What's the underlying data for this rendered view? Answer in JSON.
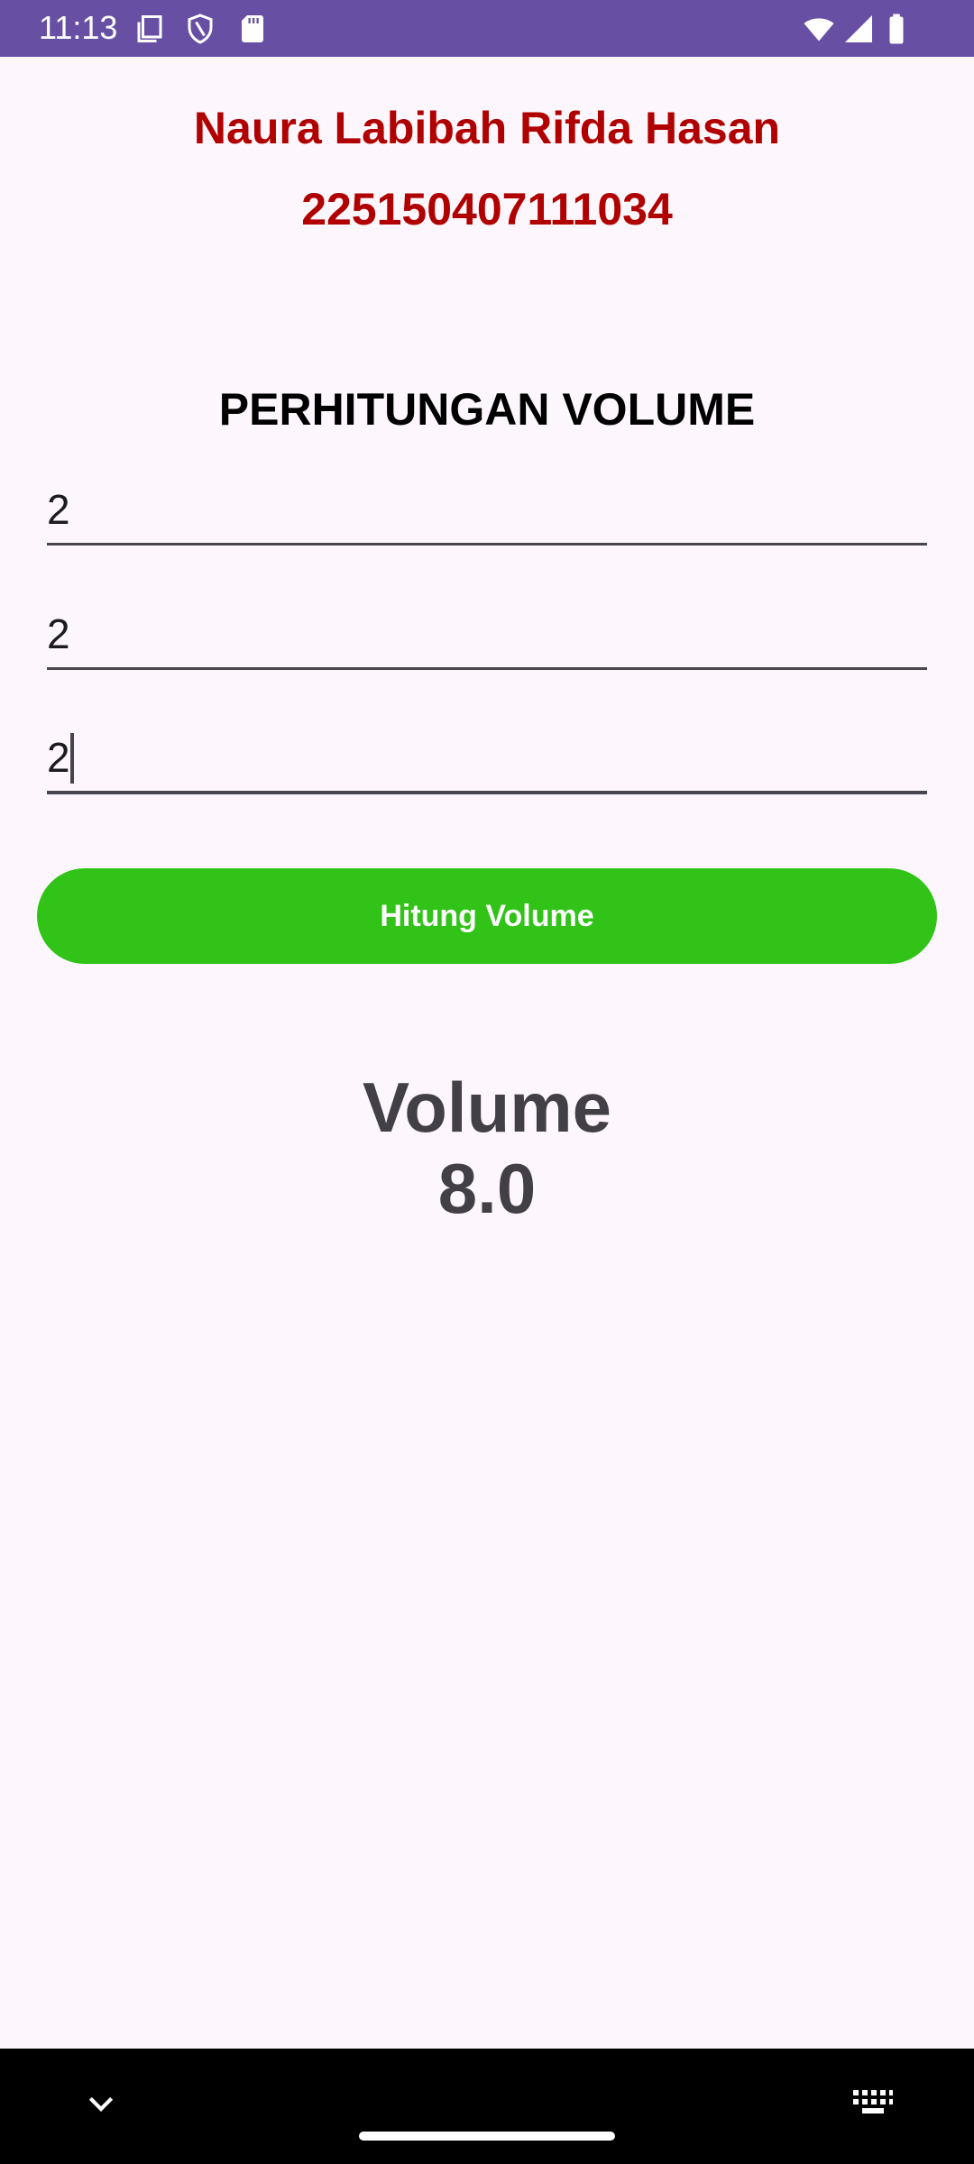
{
  "status_bar": {
    "time": "11:13",
    "icons": [
      "copy-icon",
      "shield-icon",
      "sd-card-icon",
      "wifi-icon",
      "signal-icon",
      "battery-icon"
    ],
    "color": "#6750A4"
  },
  "header": {
    "name": "Naura Labibah Rifda Hasan",
    "nim": "225150407111034",
    "color": "#B00000"
  },
  "section_title": "PERHITUNGAN VOLUME",
  "inputs": [
    {
      "value": "2"
    },
    {
      "value": "2"
    },
    {
      "value": "2",
      "focused": true
    }
  ],
  "button": {
    "label": "Hitung Volume",
    "color": "#31C317"
  },
  "result": {
    "label": "Volume",
    "value": "8.0"
  },
  "nav_bar": {
    "icons": [
      "chevron-down-icon",
      "keyboard-icon"
    ]
  }
}
